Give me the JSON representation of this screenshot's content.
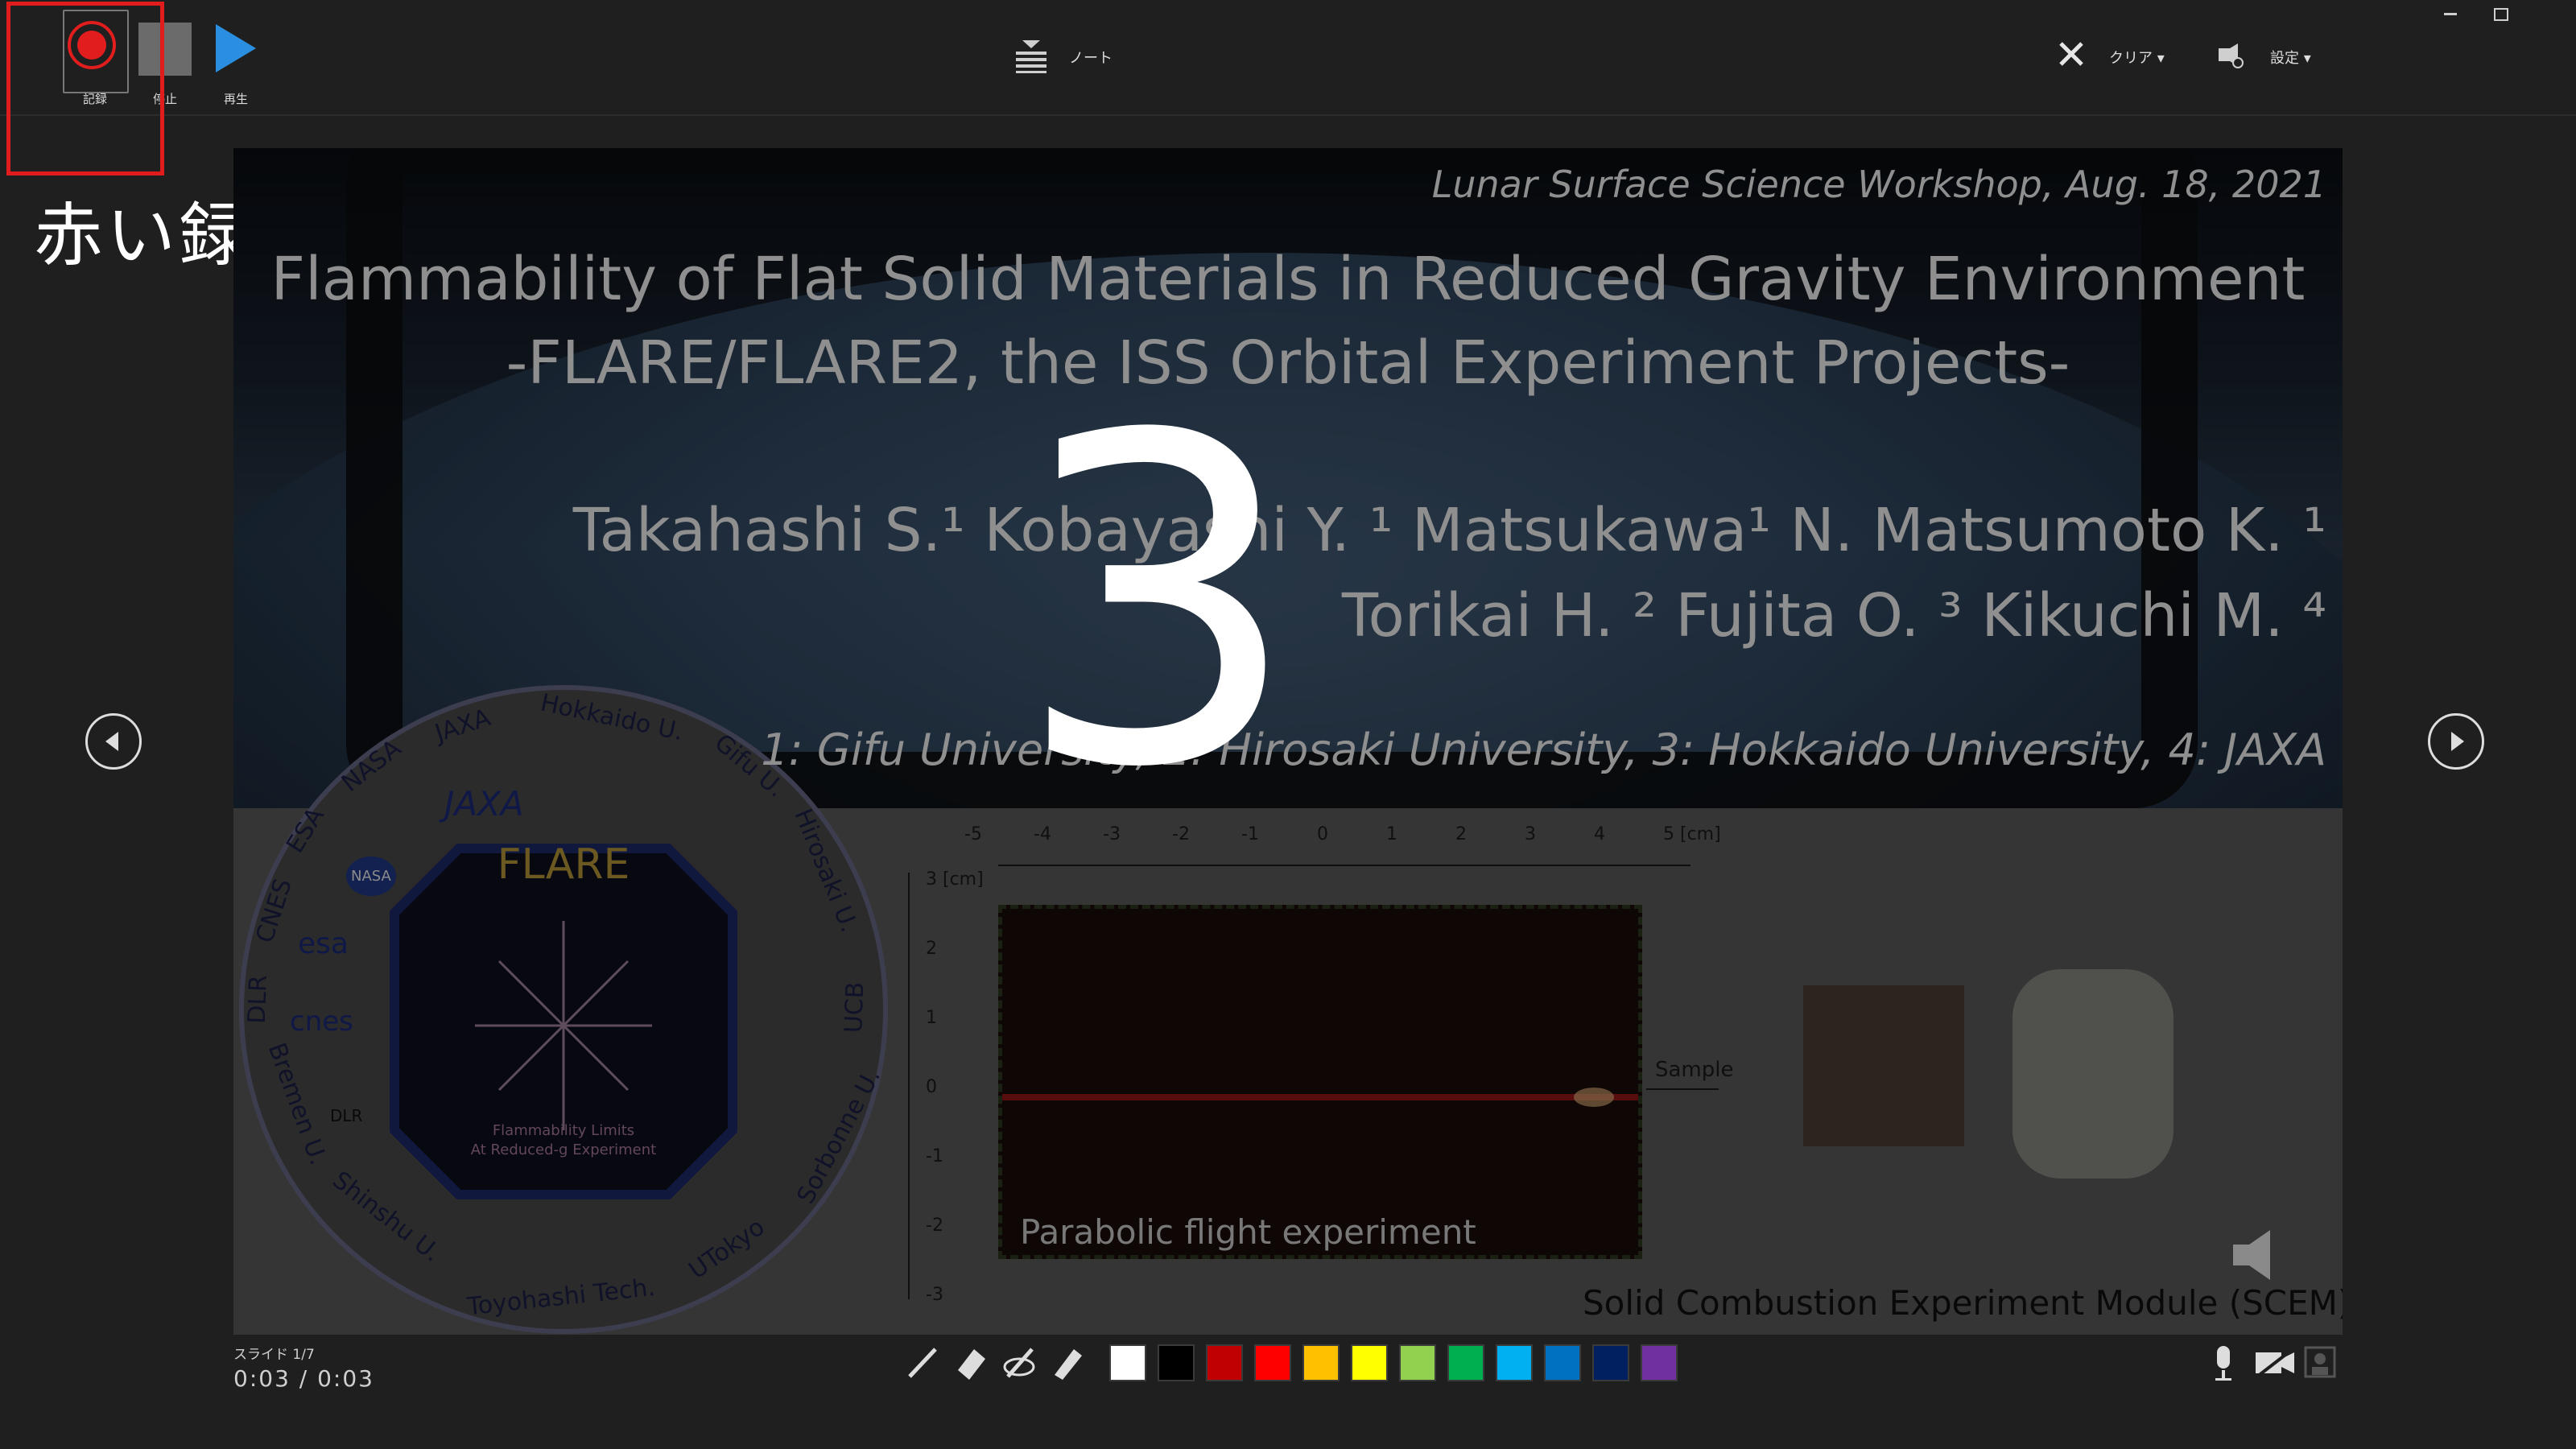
{
  "toolbar": {
    "record_label": "記録",
    "stop_label": "停止",
    "play_label": "再生",
    "notes_label": "ノート",
    "clear_label": "クリア ▾",
    "settings_label": "設定 ▾"
  },
  "callout": {
    "text": "赤い録画ボタンをクリック"
  },
  "slide": {
    "conference": "Lunar Surface Science Workshop, Aug. 18, 2021",
    "title_line1": "Flammability of Flat Solid Materials in Reduced Gravity Environment",
    "title_line2": "-FLARE/FLARE2, the ISS Orbital Experiment Projects-",
    "authors_line1": "Takahashi S.¹ Kobayashi Y. ¹ Matsukawa¹ N. Matsumoto K. ¹",
    "authors_line2": "Torikai H. ² Fujita O. ³ Kikuchi M. ⁴",
    "affiliations": "1: Gifu University, 2: Hirosaki University, 3: Hokkaido University, 4: JAXA",
    "patch": {
      "center_title": "FLARE",
      "center_sub1": "Flammability Limits",
      "center_sub2": "At Reduced-g Experiment",
      "ring_labels": [
        "Hokkaido U.",
        "Gifu U.",
        "Hirosaki U.",
        "UCB",
        "Sorbonne U.",
        "UTokyo",
        "Toyohashi Tech.",
        "Shinshu U.",
        "Bremen U.",
        "DLR",
        "CNES",
        "ESA",
        "NASA",
        "JAXA"
      ],
      "logo_texts": [
        "JAXA",
        "NASA",
        "esa",
        "cnes",
        "DLR"
      ]
    },
    "axis_x": [
      "-5",
      "-4",
      "-3",
      "-2",
      "-1",
      "0",
      "1",
      "2",
      "3",
      "4",
      "5 [cm]"
    ],
    "axis_y": [
      "3 [cm]",
      "2",
      "1",
      "0",
      "-1",
      "-2",
      "-3"
    ],
    "sample_label": "Sample",
    "flight_caption": "Parabolic flight  experiment",
    "scem_caption": "Solid Combustion Experiment Module (SCEM)"
  },
  "countdown": "3",
  "status": {
    "slide_indicator": "スライド 1/7",
    "time": "0:03 / 0:03"
  },
  "pen_colors": [
    "#ffffff",
    "#000000",
    "#c00000",
    "#ff0000",
    "#ffc000",
    "#ffff00",
    "#92d050",
    "#00b050",
    "#00b0f0",
    "#0070c0",
    "#002060",
    "#7030a0"
  ]
}
